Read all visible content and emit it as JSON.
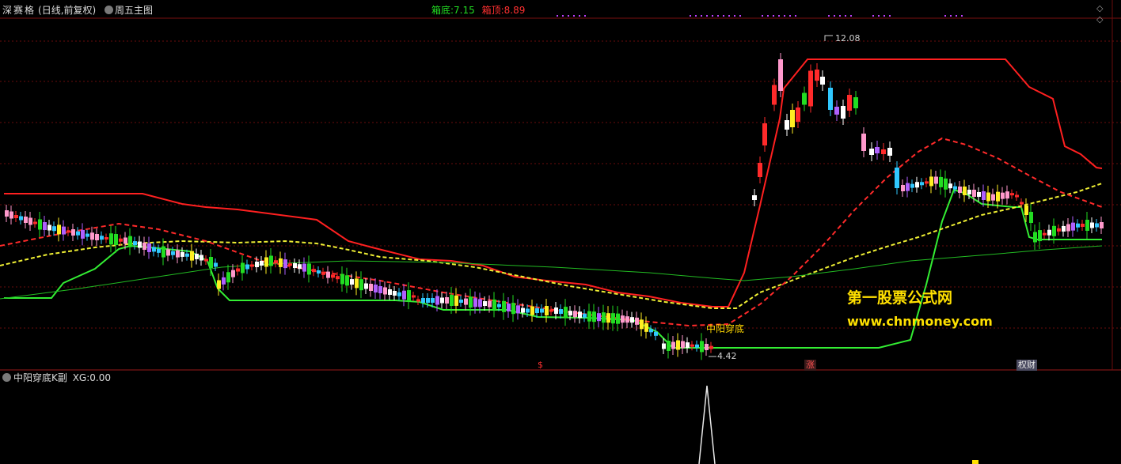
{
  "main_header": {
    "stock_name": "深赛格",
    "period_info": "(日线,前复权)",
    "template_name": "周五主图",
    "box_bottom_label": "箱底:",
    "box_bottom_value": "7.15",
    "box_top_label": "箱顶:",
    "box_top_value": "8.89"
  },
  "sub_header": {
    "indicator_name": "中阳穿底K副",
    "xg_label": "XG:",
    "xg_value": "0.00"
  },
  "annotations": {
    "high_price": "12.08",
    "low_price": "4.42",
    "signal_label": "中阳穿底"
  },
  "event_markers": [
    "$",
    "涨",
    "权财"
  ],
  "watermark": {
    "title": "第一股票公式网",
    "url": "www.chnmoney.com"
  },
  "colors": {
    "background": "#000000",
    "up": "#ff2a2a",
    "down": "#30c8ff",
    "box_line": "#ff2020",
    "support_line": "#33ee33",
    "yellow_ma": "#eeee33",
    "green_ma": "#22bb22",
    "watermark": "#ffe000",
    "header_green": "#22dd22",
    "header_red": "#ff3030"
  },
  "icons": [
    "collapse-icon",
    "diamond-up-icon",
    "diamond-down-icon"
  ]
}
